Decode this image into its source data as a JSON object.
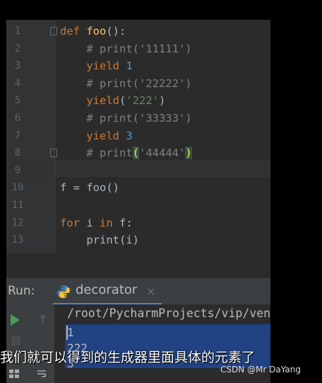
{
  "editor": {
    "lines": [
      {
        "num": "1",
        "parts": [
          [
            "kw",
            "def "
          ],
          [
            "fn",
            "foo"
          ],
          [
            "pl",
            "():"
          ]
        ]
      },
      {
        "num": "2",
        "parts": [
          [
            "cm",
            "    # print('11111')"
          ]
        ]
      },
      {
        "num": "3",
        "parts": [
          [
            "kw",
            "    yield "
          ],
          [
            "num",
            "1"
          ]
        ]
      },
      {
        "num": "4",
        "parts": [
          [
            "cm",
            "    # print('22222')"
          ]
        ]
      },
      {
        "num": "5",
        "parts": [
          [
            "kw",
            "    yield"
          ],
          [
            "pl",
            "("
          ],
          [
            "str",
            "'222'"
          ],
          [
            "pl",
            ")"
          ]
        ]
      },
      {
        "num": "6",
        "parts": [
          [
            "cm",
            "    # print('33333')"
          ]
        ]
      },
      {
        "num": "7",
        "parts": [
          [
            "kw",
            "    yield "
          ],
          [
            "num",
            "3"
          ]
        ]
      },
      {
        "num": "8",
        "parts": [
          [
            "cm",
            "    # print"
          ],
          [
            "pm",
            "("
          ],
          [
            "cm",
            "'44444'"
          ],
          [
            "pm",
            ")"
          ]
        ]
      },
      {
        "num": "9",
        "parts": []
      },
      {
        "num": "10",
        "parts": [
          [
            "pl",
            "f = foo()"
          ]
        ]
      },
      {
        "num": "11",
        "parts": []
      },
      {
        "num": "12",
        "parts": [
          [
            "kw",
            "for "
          ],
          [
            "pl",
            "i "
          ],
          [
            "kw",
            "in "
          ],
          [
            "pl",
            "f:"
          ]
        ]
      },
      {
        "num": "13",
        "parts": [
          [
            "pl",
            "    print(i)"
          ]
        ]
      }
    ]
  },
  "run_panel": {
    "label": "Run:",
    "tab_name": "decorator",
    "tab_close": "×",
    "up_arrow": "↑",
    "command_path": "/root/PycharmProjects/vip/venv",
    "output": [
      "1",
      "222",
      "3"
    ]
  },
  "overlay": {
    "subtitle": "我们就可以得到的生成器里面具体的元素了",
    "watermark": "CSDN @Mr DaYang"
  },
  "colors": {
    "keyword": "#cc7832",
    "function": "#ffc66d",
    "comment": "#808080",
    "number": "#6897bb",
    "string": "#6a8759",
    "selection": "#214283",
    "tab_underline": "#4a88c7",
    "run_green": "#499c54"
  }
}
